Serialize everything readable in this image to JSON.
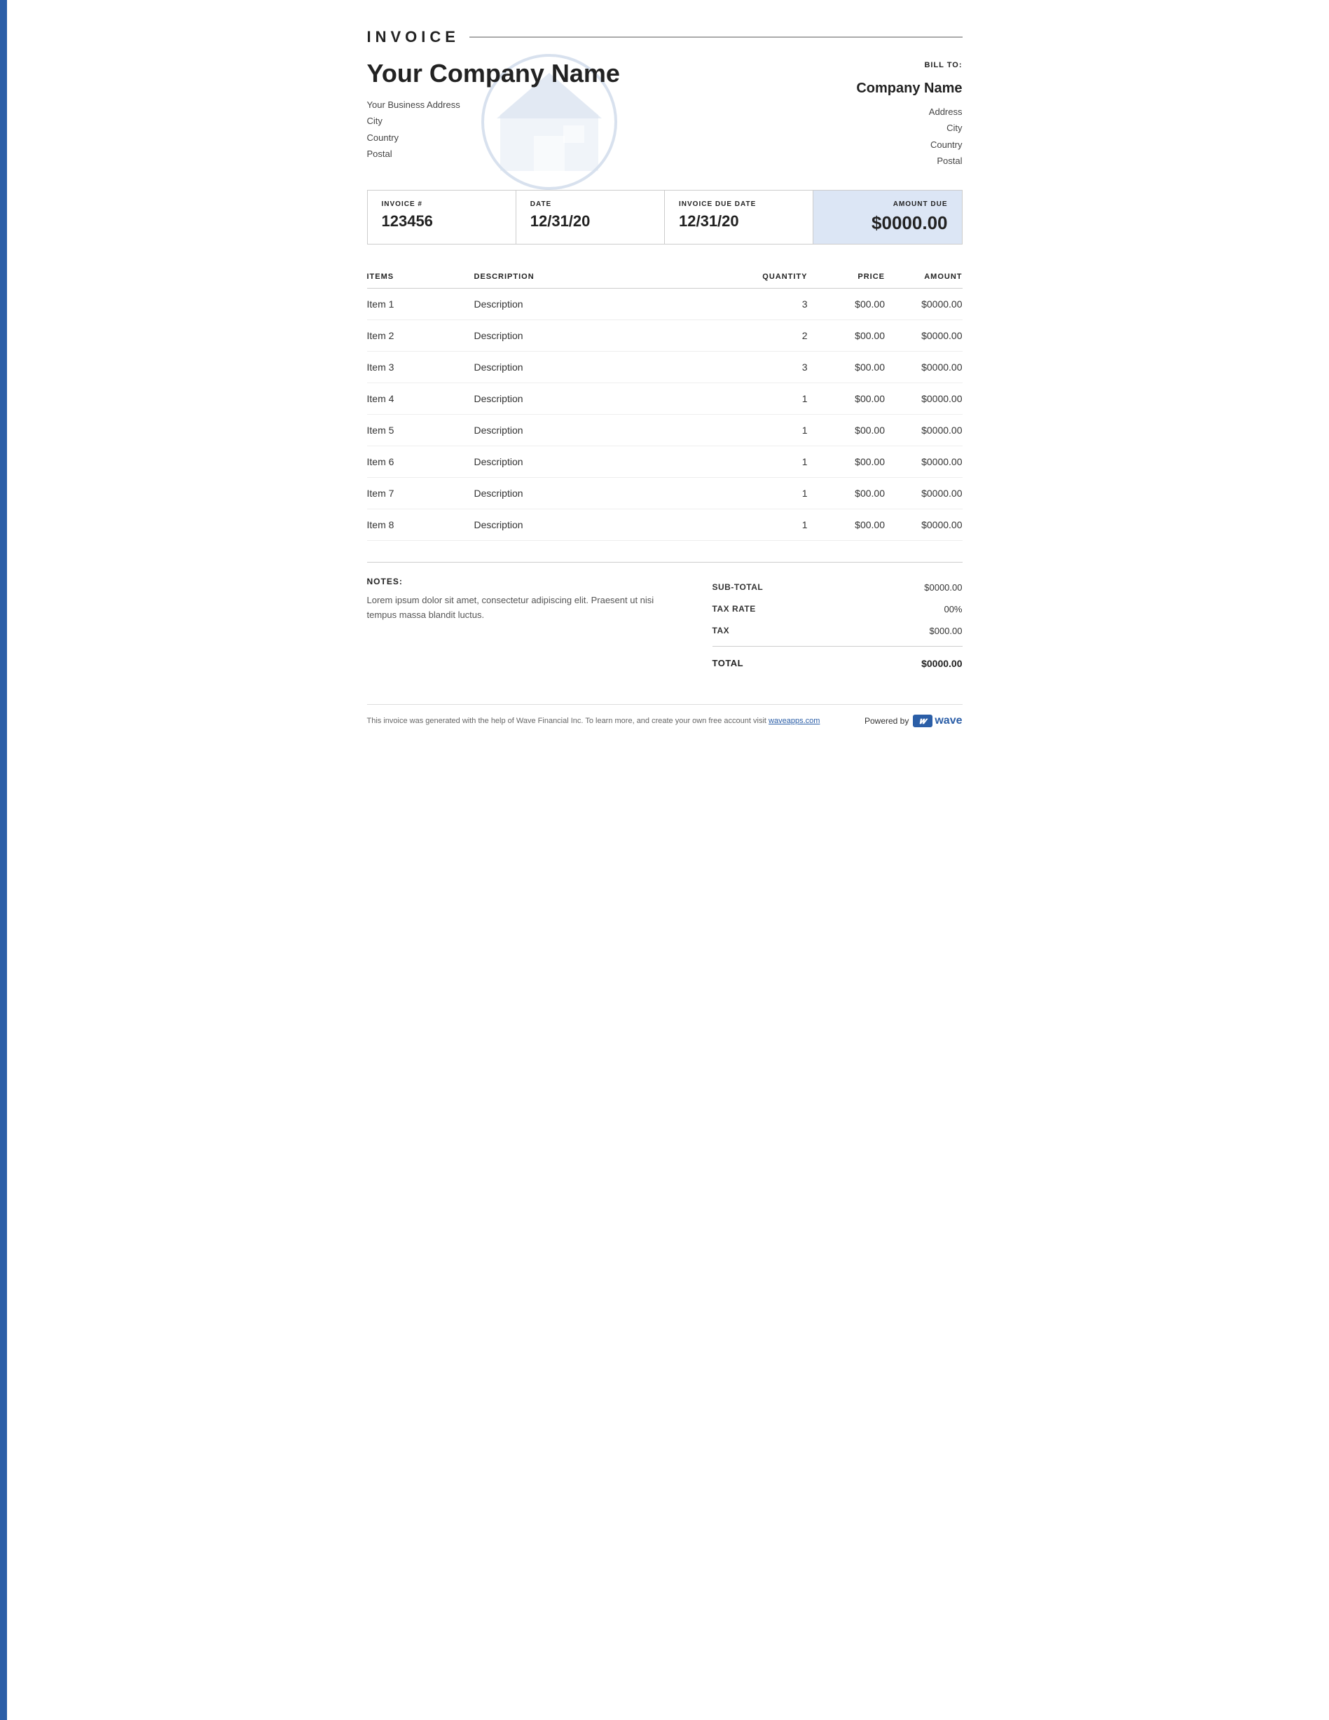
{
  "leftbar": {
    "color": "#2b5ea7"
  },
  "header": {
    "invoice_title": "INVOICE",
    "company_name": "Your Company Name",
    "address_line1": "Your Business Address",
    "address_city": "City",
    "address_country": "Country",
    "address_postal": "Postal"
  },
  "bill_to": {
    "label": "BILL TO:",
    "company_name": "Company Name",
    "address": "Address",
    "city": "City",
    "country": "Country",
    "postal": "Postal"
  },
  "meta": {
    "invoice_num_label": "INVOICE #",
    "invoice_num_value": "123456",
    "date_label": "DATE",
    "date_value": "12/31/20",
    "due_date_label": "INVOICE DUE DATE",
    "due_date_value": "12/31/20",
    "amount_due_label": "AMOUNT DUE",
    "amount_due_value": "$0000.00"
  },
  "table": {
    "col_items": "ITEMS",
    "col_description": "DESCRIPTION",
    "col_quantity": "QUANTITY",
    "col_price": "PRICE",
    "col_amount": "AMOUNT",
    "rows": [
      {
        "item": "Item 1",
        "description": "Description",
        "quantity": "3",
        "price": "$00.00",
        "amount": "$0000.00"
      },
      {
        "item": "Item 2",
        "description": "Description",
        "quantity": "2",
        "price": "$00.00",
        "amount": "$0000.00"
      },
      {
        "item": "Item 3",
        "description": "Description",
        "quantity": "3",
        "price": "$00.00",
        "amount": "$0000.00"
      },
      {
        "item": "Item 4",
        "description": "Description",
        "quantity": "1",
        "price": "$00.00",
        "amount": "$0000.00"
      },
      {
        "item": "Item 5",
        "description": "Description",
        "quantity": "1",
        "price": "$00.00",
        "amount": "$0000.00"
      },
      {
        "item": "Item 6",
        "description": "Description",
        "quantity": "1",
        "price": "$00.00",
        "amount": "$0000.00"
      },
      {
        "item": "Item 7",
        "description": "Description",
        "quantity": "1",
        "price": "$00.00",
        "amount": "$0000.00"
      },
      {
        "item": "Item 8",
        "description": "Description",
        "quantity": "1",
        "price": "$00.00",
        "amount": "$0000.00"
      }
    ]
  },
  "notes": {
    "label": "NOTES:",
    "text": "Lorem ipsum dolor sit amet, consectetur adipiscing elit. Praesent ut nisi tempus massa blandit luctus."
  },
  "totals": {
    "subtotal_label": "SUB-TOTAL",
    "subtotal_value": "$0000.00",
    "tax_rate_label": "TAX RATE",
    "tax_rate_value": "00%",
    "tax_label": "TAX",
    "tax_value": "$000.00",
    "total_label": "TOTAL",
    "total_value": "$0000.00"
  },
  "footer": {
    "text": "This invoice was generated with the help of Wave Financial Inc. To learn more, and create your own free account visit",
    "link_text": "waveapps.com",
    "link_url": "https://www.waveapps.com",
    "powered_by": "Powered by",
    "wave_label": "wave"
  }
}
